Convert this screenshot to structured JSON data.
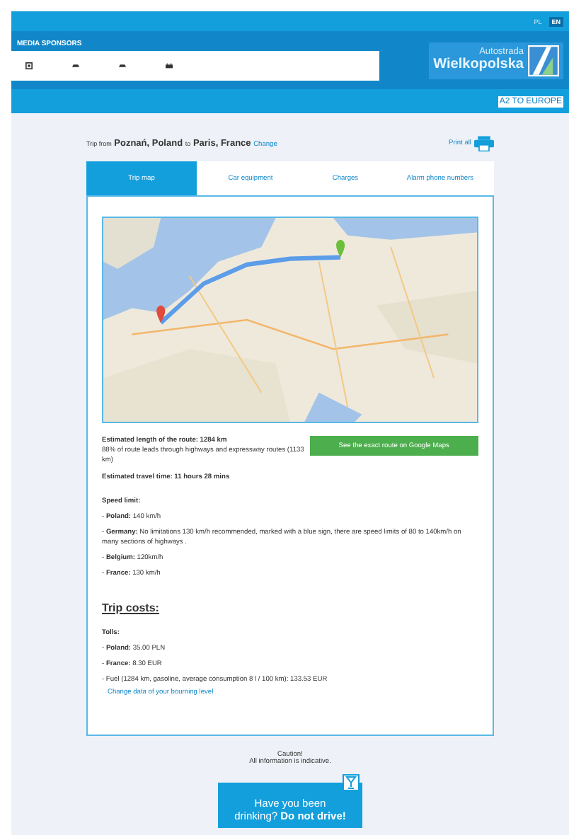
{
  "languages": [
    {
      "label": "PL",
      "selected": false
    },
    {
      "label": "EN",
      "selected": true
    }
  ],
  "sponsors_title": "MEDIA SPONSORS",
  "logo": {
    "line1": "Autostrada",
    "line2": "Wielkopolska"
  },
  "nav_link": "A2 TO EUROPE",
  "trip": {
    "prefix": "Trip from",
    "origin": "Poznań, Poland",
    "connector": "to",
    "destination": "Paris, France",
    "change_link": "Change"
  },
  "print_link": "Print all",
  "tabs": [
    {
      "label": "Trip map",
      "selected": true
    },
    {
      "label": "Car equipment",
      "selected": false
    },
    {
      "label": "Charges",
      "selected": false
    },
    {
      "label": "Alarm phone numbers",
      "selected": false
    }
  ],
  "route_button": "See the exact route on Google Maps",
  "route_length": "Estimated length of the route: 1284 km",
  "route_highways": "88% of route leads through highways and expressway routes (1133 km)",
  "travel_time": "Estimated travel time: 11 hours 28 mins",
  "speed_title": "Speed limit:",
  "speed_limits": [
    "- **Poland:** 140 km/h",
    "- **Germany:** No limitations 130 km/h recommended, marked with a blue sign, there are speed limits of 80 to 140km/h on many sections of highways .",
    "- **Belgium:** 120km/h",
    "- **France:** 130 km/h"
  ],
  "costs_title": "Trip costs:",
  "tolls_title": "Tolls:",
  "tolls": [
    "- **Poland:** 35.00 PLN",
    "- **France:** 8.30 EUR"
  ],
  "fuel": "- Fuel (1284 km, gasoline, average consumption 8 l / 100 km): 133.53 EUR",
  "fuel_link": "Change data of your bourning level",
  "caution_title": "Caution!",
  "caution_text": "All information is indicative.",
  "banner": [
    "Have you been",
    "drinking? **Do not drive!**"
  ]
}
